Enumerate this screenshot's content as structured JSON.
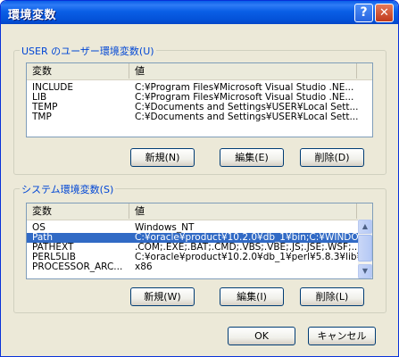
{
  "window": {
    "title": "環境変数"
  },
  "titlebar_buttons": {
    "help": "?",
    "close": "✕"
  },
  "user_group": {
    "label": "USER のユーザー環境変数(U)",
    "columns": [
      "変数",
      "値"
    ],
    "rows": [
      {
        "name": "INCLUDE",
        "value": "C:¥Program Files¥Microsoft Visual Studio .NE..."
      },
      {
        "name": "LIB",
        "value": "C:¥Program Files¥Microsoft Visual Studio .NE..."
      },
      {
        "name": "TEMP",
        "value": "C:¥Documents and Settings¥USER¥Local Sett..."
      },
      {
        "name": "TMP",
        "value": "C:¥Documents and Settings¥USER¥Local Sett..."
      }
    ],
    "buttons": {
      "new": "新規(N)",
      "edit": "編集(E)",
      "delete": "削除(D)"
    }
  },
  "system_group": {
    "label": "システム環境変数(S)",
    "columns": [
      "変数",
      "値"
    ],
    "rows": [
      {
        "name": "OS",
        "value": "Windows_NT"
      },
      {
        "name": "Path",
        "value": "C:¥oracle¥product¥10.2.0¥db_1¥bin;C:¥WINDOW...",
        "selected": true
      },
      {
        "name": "PATHEXT",
        "value": ".COM;.EXE;.BAT;.CMD;.VBS;.VBE;.JS;.JSE;.WSF;..."
      },
      {
        "name": "PERL5LIB",
        "value": "C:¥oracle¥product¥10.2.0¥db_1¥perl¥5.8.3¥lib¥..."
      },
      {
        "name": "PROCESSOR_ARC...",
        "value": "x86"
      }
    ],
    "buttons": {
      "new": "新規(W)",
      "edit": "編集(I)",
      "delete": "削除(L)"
    }
  },
  "footer": {
    "ok": "OK",
    "cancel": "キャンセル"
  }
}
